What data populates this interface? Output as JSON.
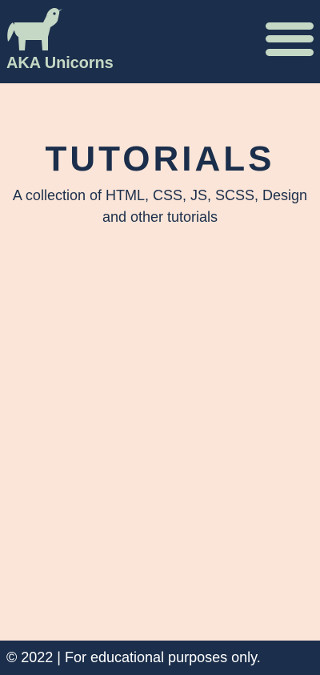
{
  "header": {
    "logo_icon": "unicorn-icon",
    "logo_text": "AKA Unicorns",
    "menu_icon": "hamburger-menu-icon"
  },
  "main": {
    "title": "TUTORIALS",
    "subtitle": "A collection of HTML, CSS, JS, SCSS, Design and other tutorials"
  },
  "footer": {
    "text": "© 2022 | For educational purposes only."
  },
  "colors": {
    "header_bg": "#1b2e4b",
    "page_bg": "#fae5d8",
    "accent": "#c5d8c5",
    "text_dark": "#1b2e4b",
    "footer_text": "#ffffff"
  }
}
